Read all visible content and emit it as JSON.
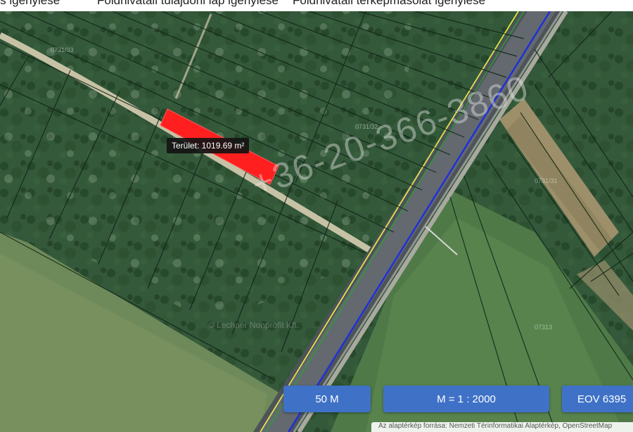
{
  "top_tabs": [
    {
      "label": "...s igénylése"
    },
    {
      "label": "Földhivatali tulajdoni lap igénylése"
    },
    {
      "label": "Földhivatali térképmásolat igénylése"
    }
  ],
  "area_label": "Terület: 1019.69 m²",
  "scale_bar": {
    "label": "50 M"
  },
  "ratio": {
    "label": "M = 1 : 2000"
  },
  "coords": {
    "label": "EOV 6395"
  },
  "attribution": "Az alaptérkép forrása: Nemzeti Térinformatikai Alaptérkép, OpenStreetMap",
  "watermark": {
    "phone": "+36-20-366-3860",
    "lechner": "© Lechner Nonprofit Kft."
  },
  "parcel_numbers": [
    "0731/33",
    "0731/32",
    "0731/31",
    "07313"
  ],
  "colors": {
    "parcel_fill": "#ff1f1f",
    "button": "#3f72c7",
    "road_line_blue": "#2030d8",
    "road_line_yellow": "#e3e34a",
    "road_line_green": "#2e9a3a"
  }
}
